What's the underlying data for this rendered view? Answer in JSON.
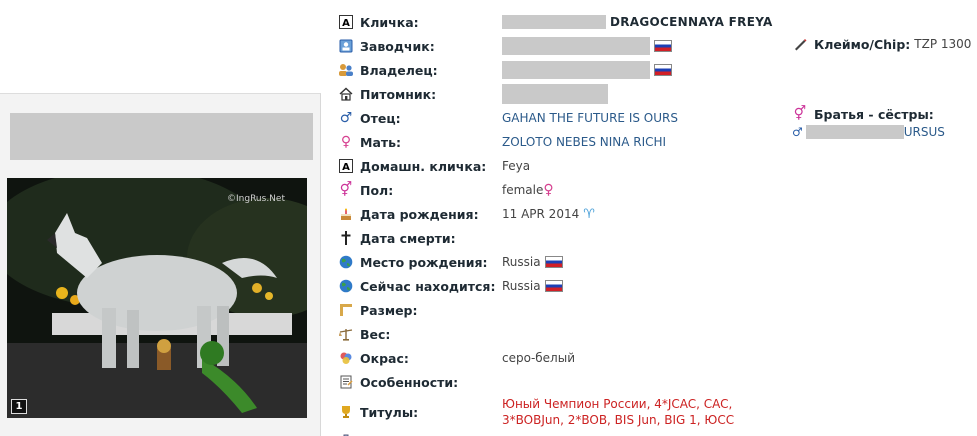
{
  "photo": {
    "watermark": "©IngRus.Net",
    "index": "1"
  },
  "dog": {
    "nickname": {
      "label": "Кличка:",
      "value": "DRAGOCENNAYA FREYA"
    },
    "breeder": {
      "label": "Заводчик:"
    },
    "owner": {
      "label": "Владелец:"
    },
    "kennel": {
      "label": "Питомник:"
    },
    "father": {
      "label": "Отец:",
      "value": "GAHAN THE FUTURE IS OURS"
    },
    "mother": {
      "label": "Мать:",
      "value": "ZOLOTO NEBES NINA RICHI"
    },
    "home_name": {
      "label": "Домашн. кличка:",
      "value": "Feya"
    },
    "sex": {
      "label": "Пол:",
      "value": "female"
    },
    "birth_date": {
      "label": "Дата рождения:",
      "value": "11 APR 2014"
    },
    "death_date": {
      "label": "Дата смерти:"
    },
    "birth_place": {
      "label": "Место рождения:",
      "value": "Russia"
    },
    "location": {
      "label": "Сейчас находится:",
      "value": "Russia"
    },
    "size": {
      "label": "Размер:"
    },
    "weight": {
      "label": "Вес:"
    },
    "color": {
      "label": "Окрас:",
      "value": "серо-белый"
    },
    "features": {
      "label": "Особенности:"
    },
    "titles": {
      "label": "Титулы:",
      "line1": "Юный Чемпион России, 4*JCAC, CAC,",
      "line2": "3*BOBJun, 2*BOB, BIS Jun, BIG 1, ЮСС"
    }
  },
  "chip": {
    "label": "Клеймо/Chip:",
    "value": "TZP 1300"
  },
  "siblings": {
    "label": "Братья - сёстры:",
    "sibling_suffix": "URSUS"
  },
  "icons": {
    "nickname": "letter-a-icon",
    "breeder": "id-card-icon",
    "owner": "people-icon",
    "kennel": "house-icon",
    "father": "male-icon",
    "mother": "female-icon",
    "home_name": "letter-a-icon",
    "sex": "gender-icon",
    "birth_date": "cake-icon",
    "death_date": "cross-icon",
    "birth_place": "globe-icon",
    "location": "globe-icon",
    "size": "ruler-icon",
    "weight": "scale-icon",
    "color": "palette-icon",
    "features": "notepad-icon",
    "titles": "trophy-icon",
    "chip": "pen-icon"
  }
}
